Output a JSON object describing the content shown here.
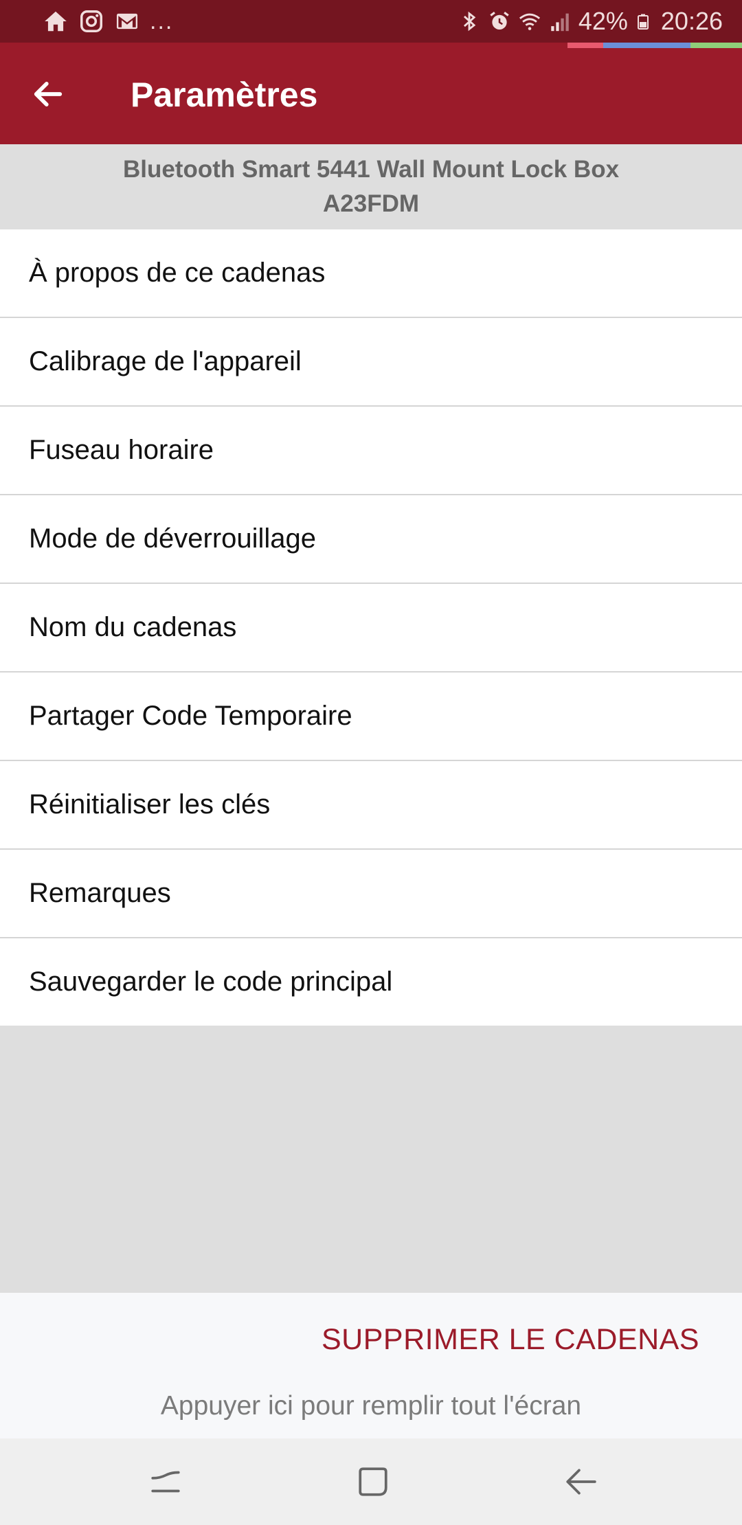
{
  "status_bar": {
    "left_icons": [
      "home-icon",
      "instagram-icon",
      "gmail-icon"
    ],
    "more_notifications": "...",
    "right_icons": [
      "bluetooth-icon",
      "alarm-icon",
      "wifi-icon",
      "signal-icon",
      "battery-icon"
    ],
    "battery_percent": "42%",
    "time": "20:26",
    "background_color": "#741520"
  },
  "progress_strip_colors": [
    "#e85a6e",
    "#6b8fd8",
    "#8fcf7a"
  ],
  "app_bar": {
    "back_icon": "arrow-left-icon",
    "title": "Paramètres",
    "background_color": "#9b1b2a"
  },
  "lock_header": {
    "model": "Bluetooth Smart 5441 Wall Mount Lock Box",
    "device_id": "A23FDM"
  },
  "menu": {
    "items": [
      {
        "label": "À propos de ce cadenas"
      },
      {
        "label": "Calibrage de l'appareil"
      },
      {
        "label": "Fuseau horaire"
      },
      {
        "label": "Mode de déverrouillage"
      },
      {
        "label": "Nom du cadenas"
      },
      {
        "label": "Partager Code Temporaire"
      },
      {
        "label": "Réinitialiser les clés"
      },
      {
        "label": "Remarques"
      },
      {
        "label": "Sauvegarder le code principal"
      }
    ]
  },
  "actions": {
    "delete_label": "SUPPRIMER LE CADENAS",
    "delete_color": "#9b1b2a",
    "fullscreen_hint": "Appuyer ici pour remplir tout l'écran"
  },
  "nav_bar": {
    "buttons": [
      "recent-apps-icon",
      "home-button-icon",
      "back-icon"
    ]
  }
}
